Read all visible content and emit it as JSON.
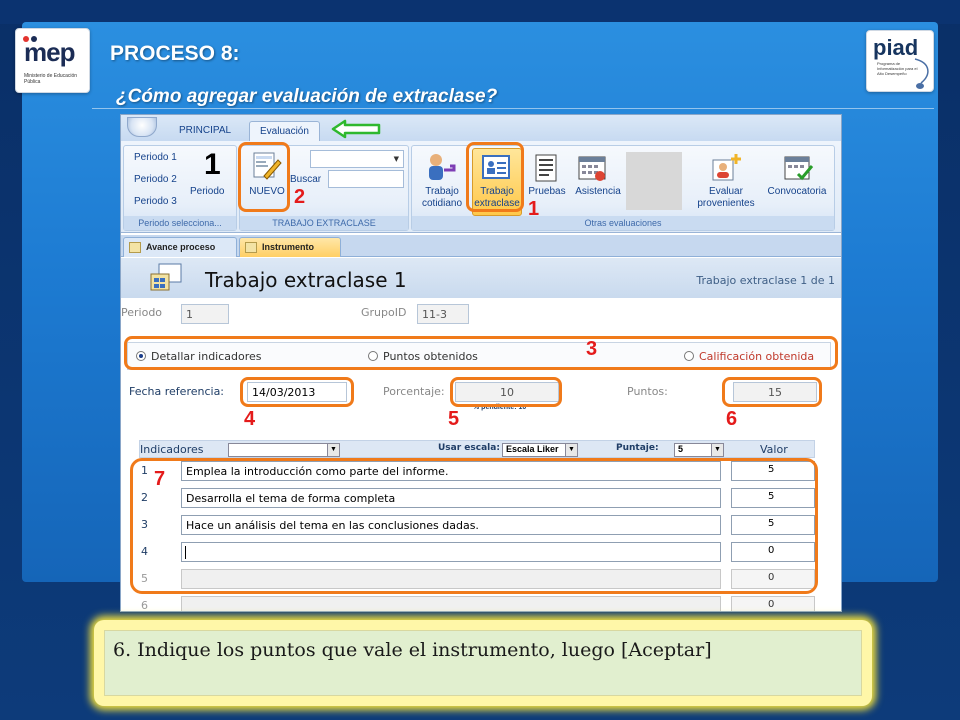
{
  "slide": {
    "title": "PROCESO 8:",
    "subtitle": "¿Cómo  agregar evaluación de extraclase?",
    "mep_logo": {
      "brand": "mep",
      "sub": "Ministerio de Educación Pública"
    },
    "piad_logo": {
      "brand": "piad",
      "sub": "Programa de Informatización para el Alto Desempeño"
    }
  },
  "ribbon": {
    "tabs": [
      "PRINCIPAL",
      "Evaluación"
    ],
    "periodo_group": {
      "items": [
        "Periodo 1",
        "Periodo 2",
        "Periodo 3"
      ],
      "current": "1",
      "button": "Periodo",
      "label": "Periodo selecciona..."
    },
    "extraclase_group": {
      "nuevo": "NUEVO",
      "buscar": "Buscar",
      "label": "TRABAJO EXTRACLASE"
    },
    "otras_group": {
      "buttons": [
        {
          "label1": "Trabajo",
          "label2": "cotidiano",
          "icon": "person-arrow-icon"
        },
        {
          "label1": "Trabajo",
          "label2": "extraclase",
          "icon": "assignment-card-icon"
        },
        {
          "label1": "Pruebas",
          "label2": "",
          "icon": "test-document-icon"
        },
        {
          "label1": "Asistencia",
          "label2": "",
          "icon": "calendar-grid-icon"
        },
        {
          "label1": "Evaluar",
          "label2": "provenientes",
          "icon": "person-plus-icon"
        },
        {
          "label1": "Convocatoria",
          "label2": "",
          "icon": "calendar-check-icon"
        }
      ],
      "label": "Otras evaluaciones"
    }
  },
  "doc_tabs": [
    "Avance proceso",
    "Instrumento"
  ],
  "form": {
    "title": "Trabajo extraclase 1",
    "record_count": "Trabajo extraclase 1 de 1",
    "periodo_label": "Periodo",
    "periodo_value": "1",
    "grupo_label": "GrupoID",
    "grupo_value": "11-3",
    "options": [
      "Detallar indicadores",
      "Puntos obtenidos",
      "Calificación obtenida"
    ],
    "fecha_label": "Fecha referencia:",
    "fecha_value": "14/03/2013",
    "porcentaje_label": "Porcentaje:",
    "porcentaje_value": "10",
    "pendiente": "% pendiente: 10",
    "puntos_label": "Puntos:",
    "puntos_value": "15",
    "indicadores_header": "Indicadores",
    "usar_escala_label": "Usar escala:",
    "escala_value": "Escala Liker",
    "puntaje_label": "Puntaje:",
    "puntaje_value": "5",
    "valor_header": "Valor",
    "rows": [
      {
        "n": "1",
        "text": "Emplea la introducción como parte del informe.",
        "val": "5"
      },
      {
        "n": "2",
        "text": "Desarrolla el tema de forma completa",
        "val": "5"
      },
      {
        "n": "3",
        "text": "Hace un análisis del tema en las conclusiones dadas.",
        "val": "5"
      },
      {
        "n": "4",
        "text": "",
        "val": "0"
      },
      {
        "n": "5",
        "text": "",
        "val": "0"
      },
      {
        "n": "6",
        "text": "",
        "val": "0"
      }
    ]
  },
  "annotations": [
    "1",
    "2",
    "3",
    "4",
    "5",
    "6",
    "7"
  ],
  "instruction": "6. Indique los puntos que vale el instrumento, luego [Aceptar]",
  "colors": {
    "highlight": "#f07a1a",
    "annotation": "#e41b1b",
    "slide_blue": "#1d7bd2"
  }
}
